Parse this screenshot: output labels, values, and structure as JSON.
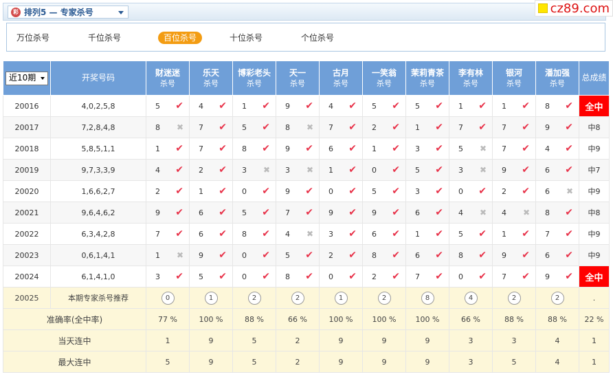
{
  "header": {
    "title": "排列5 — 专家杀号",
    "logo_text": "cz89.com"
  },
  "tabs": [
    {
      "label": "万位杀号",
      "active": false
    },
    {
      "label": "千位杀号",
      "active": false
    },
    {
      "label": "百位杀号",
      "active": true
    },
    {
      "label": "十位杀号",
      "active": false
    },
    {
      "label": "个位杀号",
      "active": false
    }
  ],
  "table": {
    "period_select": "近10期",
    "draw_header": "开奖号码",
    "experts": [
      {
        "name": "财迷迷",
        "sub": "杀号"
      },
      {
        "name": "乐天",
        "sub": "杀号"
      },
      {
        "name": "博彩老头",
        "sub": "杀号"
      },
      {
        "name": "天一",
        "sub": "杀号"
      },
      {
        "name": "古月",
        "sub": "杀号"
      },
      {
        "name": "一笑翁",
        "sub": "杀号"
      },
      {
        "name": "茉莉青茶",
        "sub": "杀号"
      },
      {
        "name": "李有林",
        "sub": "杀号"
      },
      {
        "name": "银河",
        "sub": "杀号"
      },
      {
        "name": "潘加强",
        "sub": "杀号"
      }
    ],
    "total_header": "总成绩",
    "rows": [
      {
        "issue": "20016",
        "draw": "4,0,2,5,8",
        "kills": [
          [
            "5",
            true
          ],
          [
            "4",
            true
          ],
          [
            "1",
            true
          ],
          [
            "9",
            true
          ],
          [
            "4",
            true
          ],
          [
            "5",
            true
          ],
          [
            "5",
            true
          ],
          [
            "1",
            true
          ],
          [
            "1",
            true
          ],
          [
            "8",
            true
          ]
        ],
        "result": "全中",
        "full": true
      },
      {
        "issue": "20017",
        "draw": "7,2,8,4,8",
        "kills": [
          [
            "8",
            false
          ],
          [
            "7",
            true
          ],
          [
            "5",
            true
          ],
          [
            "8",
            false
          ],
          [
            "7",
            true
          ],
          [
            "2",
            true
          ],
          [
            "1",
            true
          ],
          [
            "7",
            true
          ],
          [
            "7",
            true
          ],
          [
            "9",
            true
          ]
        ],
        "result": "中8",
        "full": false
      },
      {
        "issue": "20018",
        "draw": "5,8,5,1,1",
        "kills": [
          [
            "1",
            true
          ],
          [
            "7",
            true
          ],
          [
            "8",
            true
          ],
          [
            "9",
            true
          ],
          [
            "6",
            true
          ],
          [
            "1",
            true
          ],
          [
            "3",
            true
          ],
          [
            "5",
            false
          ],
          [
            "7",
            true
          ],
          [
            "4",
            true
          ]
        ],
        "result": "中9",
        "full": false
      },
      {
        "issue": "20019",
        "draw": "9,7,3,3,9",
        "kills": [
          [
            "4",
            true
          ],
          [
            "2",
            true
          ],
          [
            "3",
            false
          ],
          [
            "3",
            false
          ],
          [
            "1",
            true
          ],
          [
            "0",
            true
          ],
          [
            "5",
            true
          ],
          [
            "3",
            false
          ],
          [
            "9",
            true
          ],
          [
            "6",
            true
          ]
        ],
        "result": "中7",
        "full": false
      },
      {
        "issue": "20020",
        "draw": "1,6,6,2,7",
        "kills": [
          [
            "2",
            true
          ],
          [
            "1",
            true
          ],
          [
            "0",
            true
          ],
          [
            "9",
            true
          ],
          [
            "0",
            true
          ],
          [
            "5",
            true
          ],
          [
            "3",
            true
          ],
          [
            "0",
            true
          ],
          [
            "2",
            true
          ],
          [
            "6",
            false
          ]
        ],
        "result": "中9",
        "full": false
      },
      {
        "issue": "20021",
        "draw": "9,6,4,6,2",
        "kills": [
          [
            "9",
            true
          ],
          [
            "6",
            true
          ],
          [
            "5",
            true
          ],
          [
            "7",
            true
          ],
          [
            "9",
            true
          ],
          [
            "9",
            true
          ],
          [
            "6",
            true
          ],
          [
            "4",
            false
          ],
          [
            "4",
            false
          ],
          [
            "8",
            true
          ]
        ],
        "result": "中8",
        "full": false
      },
      {
        "issue": "20022",
        "draw": "6,3,4,2,8",
        "kills": [
          [
            "7",
            true
          ],
          [
            "6",
            true
          ],
          [
            "8",
            true
          ],
          [
            "4",
            false
          ],
          [
            "3",
            true
          ],
          [
            "6",
            true
          ],
          [
            "1",
            true
          ],
          [
            "5",
            true
          ],
          [
            "1",
            true
          ],
          [
            "7",
            true
          ]
        ],
        "result": "中9",
        "full": false
      },
      {
        "issue": "20023",
        "draw": "0,6,1,4,1",
        "kills": [
          [
            "1",
            false
          ],
          [
            "9",
            true
          ],
          [
            "0",
            true
          ],
          [
            "5",
            true
          ],
          [
            "2",
            true
          ],
          [
            "8",
            true
          ],
          [
            "6",
            true
          ],
          [
            "8",
            true
          ],
          [
            "9",
            true
          ],
          [
            "6",
            true
          ]
        ],
        "result": "中9",
        "full": false
      },
      {
        "issue": "20024",
        "draw": "6,1,4,1,0",
        "kills": [
          [
            "3",
            true
          ],
          [
            "5",
            true
          ],
          [
            "0",
            true
          ],
          [
            "8",
            true
          ],
          [
            "0",
            true
          ],
          [
            "2",
            true
          ],
          [
            "7",
            true
          ],
          [
            "0",
            true
          ],
          [
            "7",
            true
          ],
          [
            "9",
            true
          ]
        ],
        "result": "全中",
        "full": true
      }
    ],
    "recommend": {
      "issue": "20025",
      "label": "本期专家杀号推荐",
      "numbers": [
        "0",
        "1",
        "2",
        "2",
        "1",
        "2",
        "8",
        "4",
        "2",
        "2"
      ],
      "total": "."
    },
    "accuracy": {
      "label": "准确率(全中率)",
      "values": [
        "77 %",
        "100 %",
        "88 %",
        "66 %",
        "100 %",
        "100 %",
        "100 %",
        "66 %",
        "88 %",
        "88 %"
      ],
      "total": "22 %"
    },
    "streak_today": {
      "label": "当天连中",
      "values": [
        "1",
        "9",
        "5",
        "2",
        "9",
        "9",
        "9",
        "3",
        "3",
        "4"
      ],
      "total": "1"
    },
    "streak_max": {
      "label": "最大连中",
      "values": [
        "5",
        "9",
        "5",
        "2",
        "9",
        "9",
        "9",
        "3",
        "5",
        "4"
      ],
      "total": "1"
    }
  }
}
